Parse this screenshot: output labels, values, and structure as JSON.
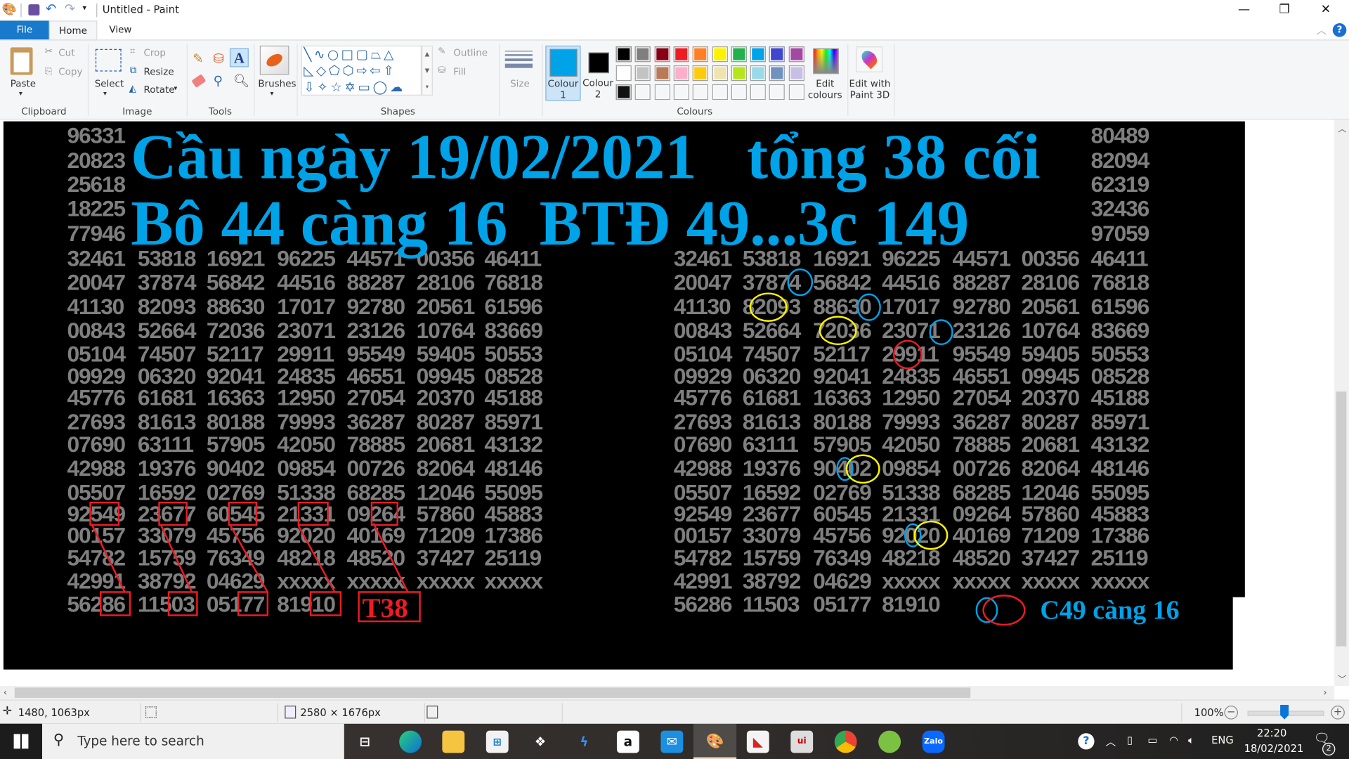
{
  "window": {
    "title": "Untitled - Paint",
    "controls": {
      "minimize": "—",
      "restore": "❐",
      "close": "✕"
    }
  },
  "tabs": [
    {
      "label": "File"
    },
    {
      "label": "Home"
    },
    {
      "label": "View"
    }
  ],
  "ribbon": {
    "clipboard": {
      "label": "Clipboard",
      "paste": "Paste",
      "cut": "Cut",
      "copy": "Copy"
    },
    "image": {
      "label": "Image",
      "select": "Select",
      "crop": "Crop",
      "resize": "Resize",
      "rotate": "Rotate"
    },
    "tools": {
      "label": "Tools"
    },
    "brushes": {
      "label": "Brushes"
    },
    "shapes": {
      "label": "Shapes",
      "outline": "Outline",
      "fill": "Fill"
    },
    "size": {
      "label": "Size"
    },
    "colours": {
      "label": "Colours",
      "colour1": "Colour 1",
      "colour1_value": "#00a2e8",
      "colour2": "Colour 2",
      "colour2_value": "#000000",
      "palette": [
        [
          "#000000",
          "#7f7f7f",
          "#880015",
          "#ed1c24",
          "#ff7f27",
          "#fff200",
          "#22b14c",
          "#00a2e8",
          "#3f48cc",
          "#a349a4"
        ],
        [
          "#ffffff",
          "#c3c3c3",
          "#b97a57",
          "#ffaec9",
          "#ffc90e",
          "#efe4b0",
          "#b5e61d",
          "#99d9ea",
          "#7092be",
          "#c8bfe7"
        ],
        [
          "#111111",
          "",
          "",
          "",
          "",
          "",
          "",
          "",
          "",
          ""
        ]
      ],
      "edit_colours": "Edit colours"
    },
    "paint3d": {
      "label": "Edit with Paint 3D"
    }
  },
  "canvas": {
    "headline": {
      "line1a": "Cầu ngày 19/02/2021",
      "line1b": "tổng 38 cối",
      "line2": "Bô 44 càng 16  BTĐ 49...3c 149",
      "color": "#00a2e8"
    },
    "left_label": "T38",
    "right_label": "C49 càng 16",
    "annotation_colors": {
      "box": "#ed1c24",
      "blue": "#00a2e8",
      "yellow": "#fff200",
      "red": "#ed1c24"
    },
    "grid": {
      "header_left": [
        "96331",
        "20823",
        "25618",
        "18225",
        "77946"
      ],
      "header_right": [
        "80489",
        "82094",
        "62319",
        "32436",
        "97059"
      ],
      "rows": [
        [
          "32461",
          "53818",
          "16921",
          "96225",
          "44571",
          "00356",
          "46411"
        ],
        [
          "20047",
          "37874",
          "56842",
          "44516",
          "88287",
          "28106",
          "76818"
        ],
        [
          "41130",
          "82093",
          "88630",
          "17017",
          "92780",
          "20561",
          "61596"
        ],
        [
          "00843",
          "52664",
          "72036",
          "23071",
          "23126",
          "10764",
          "83669"
        ],
        [
          "05104",
          "74507",
          "52117",
          "29911",
          "95549",
          "59405",
          "50553"
        ],
        [
          "09929",
          "06320",
          "92041",
          "24835",
          "46551",
          "09945",
          "08528"
        ],
        [
          "45776",
          "61681",
          "16363",
          "12950",
          "27054",
          "20370",
          "45188"
        ],
        [
          "27693",
          "81613",
          "80188",
          "79993",
          "36287",
          "80287",
          "85971"
        ],
        [
          "07690",
          "63111",
          "57905",
          "42050",
          "78885",
          "20681",
          "43132"
        ],
        [
          "42988",
          "19376",
          "90402",
          "09854",
          "00726",
          "82064",
          "48146"
        ],
        [
          "05507",
          "16592",
          "02769",
          "51338",
          "68285",
          "12046",
          "55095"
        ],
        [
          "92549",
          "23677",
          "60545",
          "21331",
          "09264",
          "57860",
          "45883"
        ],
        [
          "00157",
          "33079",
          "45756",
          "92020",
          "40169",
          "71209",
          "17386"
        ],
        [
          "54782",
          "15759",
          "76349",
          "48218",
          "48520",
          "37427",
          "25119"
        ],
        [
          "42991",
          "38792",
          "04629",
          "xxxxx",
          "xxxxx",
          "xxxxx",
          "xxxxx"
        ],
        [
          "56286",
          "11503",
          "05177",
          "81910"
        ]
      ]
    }
  },
  "status": {
    "cursor": "1480, 1063px",
    "image_size": "2580 × 1676px",
    "zoom": "100%",
    "zoom_level_percent": 100
  },
  "taskbar": {
    "search_placeholder": "Type here to search",
    "language": "ENG",
    "time": "22:20",
    "date": "18/02/2021",
    "notification_count": "2",
    "apps": [
      "task-view",
      "edge",
      "file-explorer",
      "microsoft-store",
      "dropbox",
      "blue-app",
      "amazon",
      "mail",
      "paint",
      "red-app",
      "unikey",
      "chrome",
      "coc-coc",
      "zalo"
    ]
  }
}
